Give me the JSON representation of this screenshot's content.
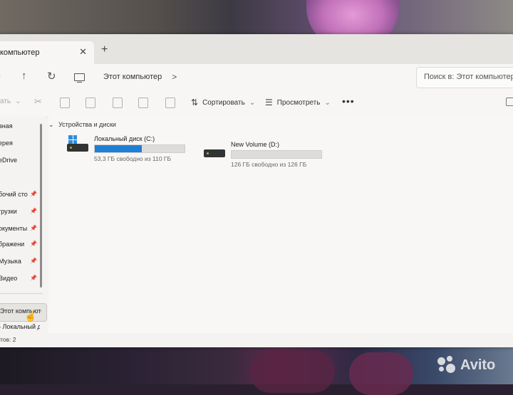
{
  "window": {
    "tab_title": "компьютер",
    "tab_close": "✕",
    "tab_new": "+"
  },
  "nav": {
    "address": "Этот компьютер",
    "address_chevron": ">",
    "search_placeholder": "Поиск в: Этот компьютер"
  },
  "toolbar": {
    "create_label": "ать",
    "sort_label": "Сортировать",
    "view_label": "Просмотреть",
    "more_label": "•••"
  },
  "sidebar": {
    "items": [
      {
        "label": "вная"
      },
      {
        "label": "ерея"
      },
      {
        "label": "eDrive"
      },
      {
        "label": "бочий сто"
      },
      {
        "label": "грузки"
      },
      {
        "label": "окументы"
      },
      {
        "label": "бражени"
      },
      {
        "label": "Музыка"
      },
      {
        "label": "Видео"
      }
    ],
    "this_pc": "Этот компьютер",
    "local_disk": "Локальный д"
  },
  "content": {
    "group_header": "Устройства и диски",
    "drives": [
      {
        "name": "Локальный диск (C:)",
        "free": "53,3 ГБ свободно из 110 ГБ",
        "used_fraction": 0.52
      },
      {
        "name": "New Volume (D:)",
        "free": "126 ГБ свободно из 126 ГБ",
        "used_fraction": 0.0
      }
    ]
  },
  "status": {
    "text": "тов: 2"
  },
  "watermark": {
    "text": "Avito"
  }
}
